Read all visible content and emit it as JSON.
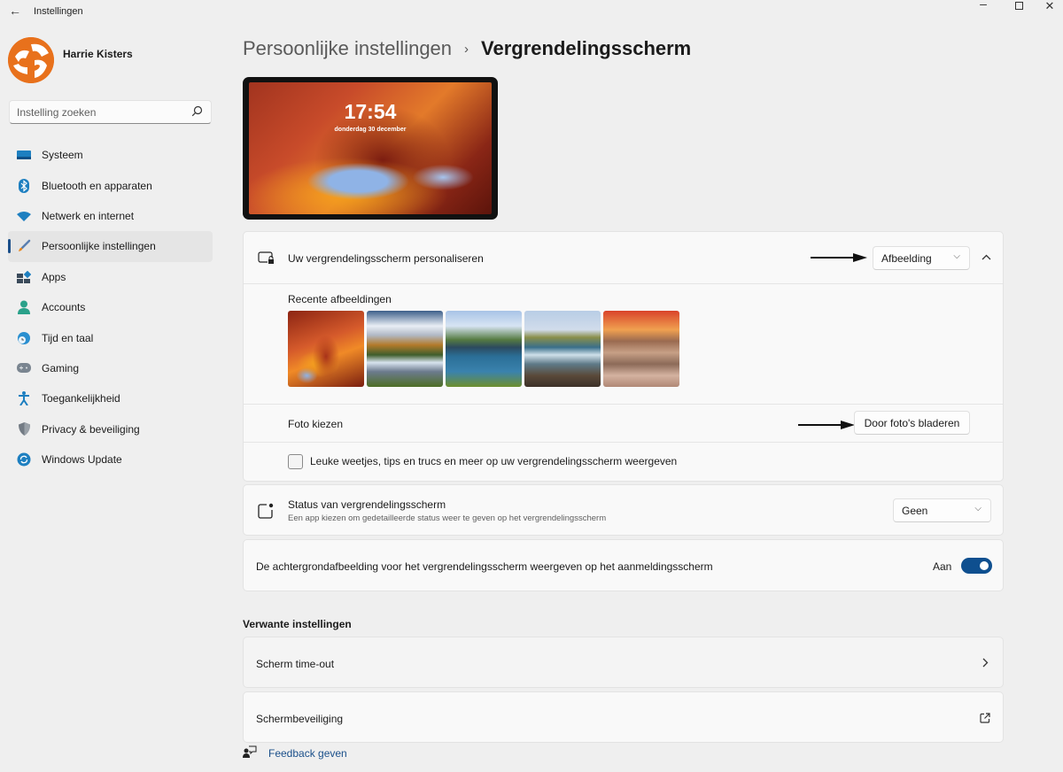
{
  "window": {
    "title": "Instellingen",
    "controls": {
      "minimize": "–",
      "maximize": "□",
      "close": "✕"
    }
  },
  "user": {
    "name": "Harrie Kisters"
  },
  "search": {
    "placeholder": "Instelling zoeken",
    "value": ""
  },
  "sidebar": {
    "items": [
      {
        "label": "Systeem",
        "icon": "monitor-icon",
        "active": false
      },
      {
        "label": "Bluetooth en apparaten",
        "icon": "bluetooth-icon",
        "active": false
      },
      {
        "label": "Netwerk en internet",
        "icon": "wifi-icon",
        "active": false
      },
      {
        "label": "Persoonlijke instellingen",
        "icon": "paintbrush-icon",
        "active": true
      },
      {
        "label": "Apps",
        "icon": "apps-icon",
        "active": false
      },
      {
        "label": "Accounts",
        "icon": "person-icon",
        "active": false
      },
      {
        "label": "Tijd en taal",
        "icon": "clock-globe-icon",
        "active": false
      },
      {
        "label": "Gaming",
        "icon": "gamepad-icon",
        "active": false
      },
      {
        "label": "Toegankelijkheid",
        "icon": "accessibility-icon",
        "active": false
      },
      {
        "label": "Privacy & beveiliging",
        "icon": "shield-icon",
        "active": false
      },
      {
        "label": "Windows Update",
        "icon": "update-icon",
        "active": false
      }
    ]
  },
  "breadcrumb": {
    "parent": "Persoonlijke instellingen",
    "separator": "›",
    "current": "Vergrendelingsscherm"
  },
  "preview": {
    "time": "17:54",
    "date": "donderdag 30 december"
  },
  "personalize": {
    "title": "Uw vergrendelingsscherm personaliseren",
    "dropdown_value": "Afbeelding",
    "expanded": true,
    "recent_label": "Recente afbeeldingen",
    "recent_images": [
      "antelope-canyon",
      "mountain-lake",
      "coastal-bay",
      "rocky-shore",
      "sunset-rocks"
    ],
    "choose_photo_label": "Foto kiezen",
    "browse_button": "Door foto's bladeren",
    "tips_checkbox_label": "Leuke weetjes, tips en trucs en meer op uw vergrendelingsscherm weergeven",
    "tips_checked": false
  },
  "status": {
    "title": "Status van vergrendelingsscherm",
    "subtitle": "Een app kiezen om gedetailleerde status weer te geven op het vergrendelingsscherm",
    "dropdown_value": "Geen"
  },
  "login_bg": {
    "title": "De achtergrondafbeelding voor het vergrendelingsscherm weergeven op het aanmeldingsscherm",
    "state_label": "Aan",
    "on": true
  },
  "related": {
    "heading": "Verwante instellingen",
    "items": [
      {
        "label": "Scherm time-out",
        "icon": "chevron-right-icon"
      },
      {
        "label": "Schermbeveiliging",
        "icon": "external-link-icon"
      }
    ]
  },
  "feedback": {
    "label": "Feedback geven"
  },
  "colors": {
    "accent": "#0e4f8f",
    "avatar": "#e8711c",
    "link": "#1a4f8a"
  }
}
